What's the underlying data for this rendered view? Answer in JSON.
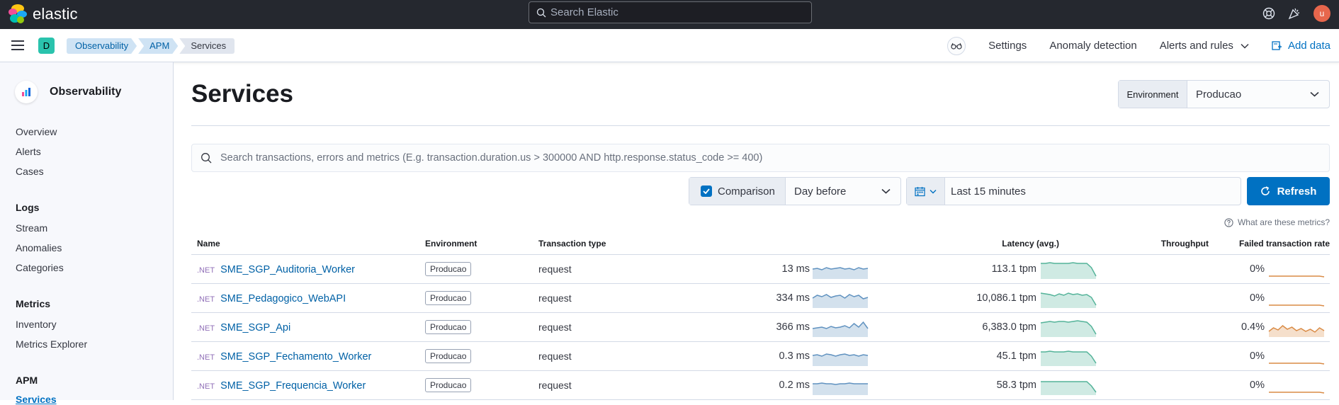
{
  "topbar": {
    "logo_text": "elastic",
    "search_placeholder": "Search Elastic",
    "user_initial": "u"
  },
  "subheader": {
    "space_initial": "D",
    "breadcrumbs": [
      "Observability",
      "APM",
      "Services"
    ],
    "links": {
      "settings": "Settings",
      "anomaly": "Anomaly detection",
      "alerts": "Alerts and rules",
      "add_data": "Add data"
    }
  },
  "sidebar": {
    "title": "Observability",
    "items": [
      "Overview",
      "Alerts",
      "Cases"
    ],
    "sections": [
      {
        "title": "Logs",
        "items": [
          "Stream",
          "Anomalies",
          "Categories"
        ]
      },
      {
        "title": "Metrics",
        "items": [
          "Inventory",
          "Metrics Explorer"
        ]
      },
      {
        "title": "APM",
        "items": [
          "Services"
        ]
      }
    ]
  },
  "main": {
    "title": "Services",
    "environment": {
      "label": "Environment",
      "value": "Producao"
    },
    "kql_placeholder": "Search transactions, errors and metrics (E.g. transaction.duration.us > 300000 AND http.response.status_code >= 400)",
    "comparison": {
      "label": "Comparison",
      "value": "Day before",
      "checked": true
    },
    "date_range": "Last 15 minutes",
    "refresh_label": "Refresh",
    "metrics_help": "What are these metrics?"
  },
  "table": {
    "columns": [
      "Name",
      "Environment",
      "Transaction type",
      "Latency (avg.)",
      "Throughput",
      "Failed transaction rate"
    ],
    "rows": [
      {
        "lang": ".NET",
        "name": "SME_SGP_Auditoria_Worker",
        "env": "Producao",
        "type": "request",
        "latency": "13 ms",
        "throughput": "113.1 tpm",
        "failed": "0%"
      },
      {
        "lang": ".NET",
        "name": "SME_Pedagogico_WebAPI",
        "env": "Producao",
        "type": "request",
        "latency": "334 ms",
        "throughput": "10,086.1 tpm",
        "failed": "0%"
      },
      {
        "lang": ".NET",
        "name": "SME_SGP_Api",
        "env": "Producao",
        "type": "request",
        "latency": "366 ms",
        "throughput": "6,383.0 tpm",
        "failed": "0.4%"
      },
      {
        "lang": ".NET",
        "name": "SME_SGP_Fechamento_Worker",
        "env": "Producao",
        "type": "request",
        "latency": "0.3 ms",
        "throughput": "45.1 tpm",
        "failed": "0%"
      },
      {
        "lang": ".NET",
        "name": "SME_SGP_Frequencia_Worker",
        "env": "Producao",
        "type": "request",
        "latency": "0.2 ms",
        "throughput": "58.3 tpm",
        "failed": "0%"
      }
    ]
  },
  "colors": {
    "latency": "#6092c0",
    "throughput": "#54b399",
    "failed": "#da8b45",
    "accent": "#0071c2"
  }
}
